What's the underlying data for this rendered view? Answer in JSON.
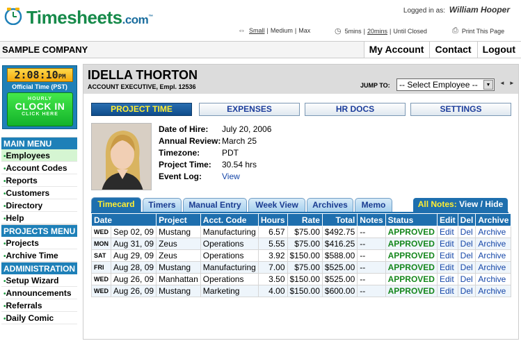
{
  "header": {
    "logo_main": "Timesheets",
    "logo_suffix": ".com",
    "logo_tm": "™",
    "logged_in_label": "Logged in as:",
    "user_name": "William Hooper",
    "text_size": {
      "small": "Small",
      "sep1": "|",
      "medium": "Medium",
      "sep2": "|",
      "max": "Max"
    },
    "timeout": {
      "five": "5mins",
      "sep1": "|",
      "twenty": "20mins",
      "sep2": "|",
      "until_closed": "Until Closed"
    },
    "print_label": "Print This Page"
  },
  "company_bar": {
    "company_name": "SAMPLE COMPANY",
    "nav": [
      "My Account",
      "Contact",
      "Logout"
    ]
  },
  "clock": {
    "time": "2:08:10",
    "ampm": "PM",
    "official_label": "Official Time (PST)",
    "btn_top": "HOURLY",
    "btn_main": "CLOCK IN",
    "btn_bottom": "CLICK HERE"
  },
  "sidebar": {
    "main_menu": {
      "title": "MAIN MENU",
      "items": [
        "Employees",
        "Account Codes",
        "Reports",
        "Customers",
        "Directory",
        "Help"
      ]
    },
    "projects_menu": {
      "title": "PROJECTS MENU",
      "items": [
        "Projects",
        "Archive Time"
      ]
    },
    "administration": {
      "title": "ADMINISTRATION",
      "items": [
        "Setup Wizard",
        "Announcements",
        "Referrals",
        "Daily Comic"
      ]
    }
  },
  "employee": {
    "name": "IDELLA THORTON",
    "title_line": "ACCOUNT EXECUTIVE, Empl. 12536",
    "info": [
      {
        "label": "Date of Hire:",
        "value": "July 20, 2006"
      },
      {
        "label": "Annual Review:",
        "value": "March 25"
      },
      {
        "label": "Timezone:",
        "value": "PDT"
      },
      {
        "label": "Project Time:",
        "value": "30.54 hrs"
      },
      {
        "label": "Event Log:",
        "value": "View"
      }
    ]
  },
  "jump": {
    "label": "JUMP TO:",
    "selected": "-- Select Employee --",
    "prev": "◄",
    "next": "►"
  },
  "main_tabs": [
    "PROJECT TIME",
    "EXPENSES",
    "HR DOCS",
    "SETTINGS"
  ],
  "sub_tabs": [
    "Timecard",
    "Timers",
    "Manual Entry",
    "Week View",
    "Archives",
    "Memo"
  ],
  "notes_bar": {
    "all_notes": "All Notes:",
    "view": "View",
    "sep": "/",
    "hide": "Hide"
  },
  "timecard": {
    "columns": [
      "Date",
      "Project",
      "Acct. Code",
      "Hours",
      "Rate",
      "Total",
      "Notes",
      "Status",
      "Edit",
      "Del",
      "Archive"
    ],
    "rows": [
      {
        "day": "WED",
        "date": "Sep 02, 09",
        "project": "Mustang",
        "acct": "Manufacturing",
        "hours": "6.57",
        "rate": "$75.00",
        "total": "$492.75",
        "notes": "--",
        "status": "APPROVED",
        "edit": "Edit",
        "del": "Del",
        "archive": "Archive"
      },
      {
        "day": "MON",
        "date": "Aug 31, 09",
        "project": "Zeus",
        "acct": "Operations",
        "hours": "5.55",
        "rate": "$75.00",
        "total": "$416.25",
        "notes": "--",
        "status": "APPROVED",
        "edit": "Edit",
        "del": "Del",
        "archive": "Archive"
      },
      {
        "day": "SAT",
        "date": "Aug 29, 09",
        "project": "Zeus",
        "acct": "Operations",
        "hours": "3.92",
        "rate": "$150.00",
        "total": "$588.00",
        "notes": "--",
        "status": "APPROVED",
        "edit": "Edit",
        "del": "Del",
        "archive": "Archive"
      },
      {
        "day": "FRI",
        "date": "Aug 28, 09",
        "project": "Mustang",
        "acct": "Manufacturing",
        "hours": "7.00",
        "rate": "$75.00",
        "total": "$525.00",
        "notes": "--",
        "status": "APPROVED",
        "edit": "Edit",
        "del": "Del",
        "archive": "Archive"
      },
      {
        "day": "WED",
        "date": "Aug 26, 09",
        "project": "Manhattan",
        "acct": "Operations",
        "hours": "3.50",
        "rate": "$150.00",
        "total": "$525.00",
        "notes": "--",
        "status": "APPROVED",
        "edit": "Edit",
        "del": "Del",
        "archive": "Archive"
      },
      {
        "day": "WED",
        "date": "Aug 26, 09",
        "project": "Mustang",
        "acct": "Marketing",
        "hours": "4.00",
        "rate": "$150.00",
        "total": "$600.00",
        "notes": "--",
        "status": "APPROVED",
        "edit": "Edit",
        "del": "Del",
        "archive": "Archive"
      }
    ]
  },
  "icons": {
    "logo_clock": "clock-icon",
    "text_size": "resize-arrows-icon",
    "timeout": "timer-icon",
    "print": "printer-icon"
  },
  "colors": {
    "brand_green": "#168a4a",
    "brand_blue": "#1e80b8",
    "approved": "#15871c",
    "link": "#1546a8",
    "active_tab_text": "#ffee33"
  }
}
